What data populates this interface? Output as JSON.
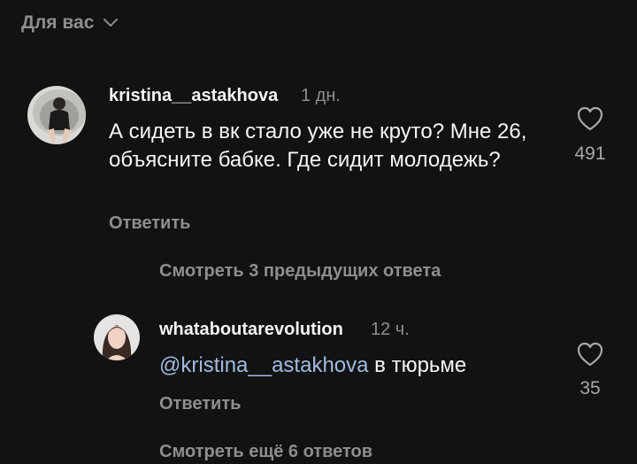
{
  "header": {
    "filter_label": "Для вас"
  },
  "comments": [
    {
      "username": "kristina__astakhova",
      "time": "1 дн.",
      "text": "А сидеть в вк стало уже не круто? Мне 26, объясните бабке. Где сидит молодежь?",
      "reply_label": "Ответить",
      "likes": "491"
    },
    {
      "view_previous_label": "Смотреть 3 предыдущих ответа",
      "username": "whataboutarevolution",
      "time": "12 ч.",
      "mention": "@kristina__astakhova",
      "text": " в тюрьме",
      "reply_label": "Ответить",
      "likes": "35"
    }
  ],
  "footer": {
    "view_more_label": "Смотреть ещё 6 ответов"
  },
  "colors": {
    "background": "#121212",
    "primary_text": "#f5f5f5",
    "secondary_text": "#8e8e8e",
    "mention": "#9fbbe0"
  }
}
